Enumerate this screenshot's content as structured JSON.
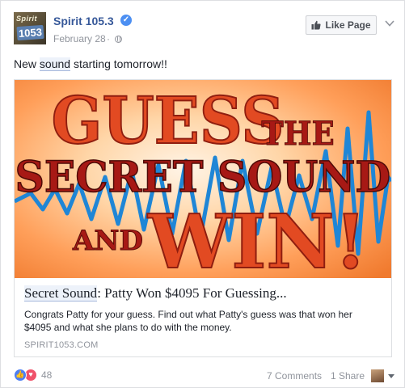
{
  "header": {
    "page_name": "Spirit 105.3",
    "date": "February 28",
    "separator": "·",
    "like_button_label": "Like Page",
    "avatar_logo_top": "Spirit",
    "avatar_logo_num": "1053"
  },
  "post": {
    "text_before": "New ",
    "text_highlight": "sound",
    "text_after": " starting tomorrow!!"
  },
  "attachment": {
    "image_text": {
      "line1": "GUESS",
      "line2": "THE",
      "line3": "SECRET SOUND",
      "line4_small": "AND",
      "line4_big": "WIN!"
    },
    "title_highlight": "Secret Sound",
    "title_rest": ": Patty Won $4095 For Guessing...",
    "description": "Congrats Patty for your guess. Find out what Patty's guess was that won her $4095 and what she plans to do with the money.",
    "domain": "SPIRIT1053.COM"
  },
  "footer": {
    "reaction_count": "48",
    "comments": "7 Comments",
    "shares": "1 Share"
  },
  "colors": {
    "link_blue": "#365899",
    "meta_gray": "#90949c",
    "banner_red": "#d93a1e",
    "banner_dark_red": "#a71915",
    "wave_blue": "#1f86d6"
  },
  "icons": [
    "verified-icon",
    "globe-icon",
    "thumbs-up-icon",
    "chevron-down-icon",
    "like-reaction-icon",
    "love-reaction-icon"
  ]
}
